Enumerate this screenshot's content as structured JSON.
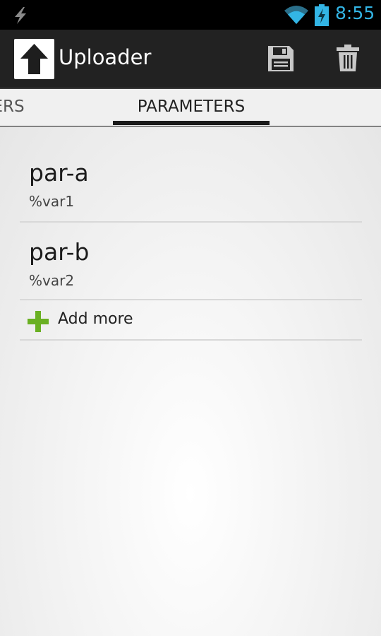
{
  "status_bar": {
    "time": "8:55",
    "icons": [
      "bolt-icon",
      "wifi-icon",
      "battery-charging-icon"
    ],
    "time_color": "#33b5e5"
  },
  "action_bar": {
    "title": "Uploader",
    "app_icon": "upload-arrow-icon",
    "actions": [
      {
        "name": "save",
        "icon": "floppy-disk-icon"
      },
      {
        "name": "delete",
        "icon": "trash-icon"
      }
    ]
  },
  "tabs": {
    "items": [
      {
        "label": "ADERS",
        "selected": false
      },
      {
        "label": "PARAMETERS",
        "selected": true
      }
    ]
  },
  "parameters": [
    {
      "name": "par-a",
      "value": "%var1"
    },
    {
      "name": "par-b",
      "value": "%var2"
    }
  ],
  "add_more": {
    "label": "Add more",
    "icon": "plus-icon",
    "icon_color": "#6ab023"
  }
}
